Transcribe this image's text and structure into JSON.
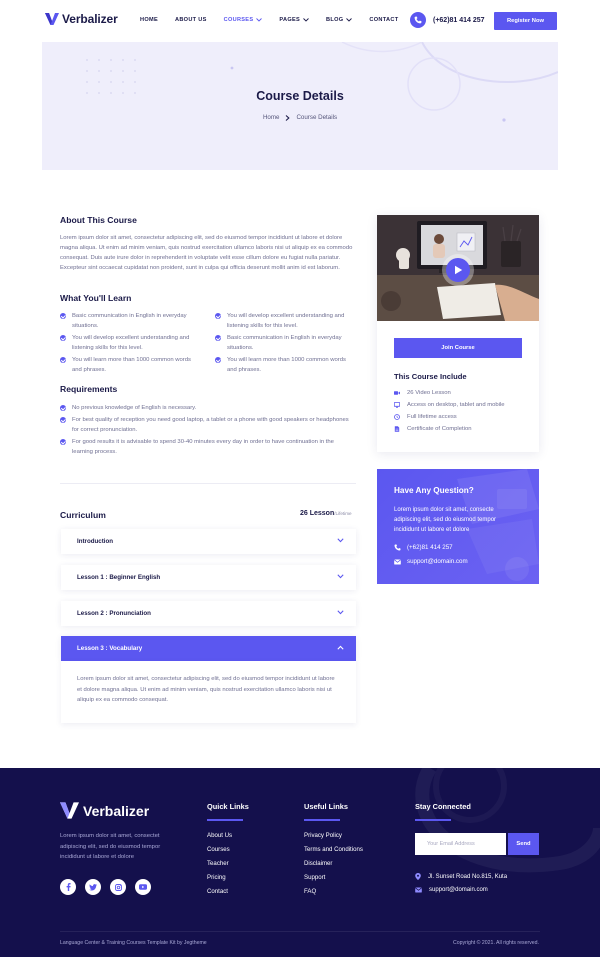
{
  "nav": {
    "brand": "Verbalizer",
    "items": [
      {
        "label": "HOME",
        "dropdown": false,
        "active": false
      },
      {
        "label": "ABOUT US",
        "dropdown": false,
        "active": false
      },
      {
        "label": "COURSES",
        "dropdown": true,
        "active": true
      },
      {
        "label": "PAGES",
        "dropdown": true,
        "active": false
      },
      {
        "label": "BLOG",
        "dropdown": true,
        "active": false
      },
      {
        "label": "CONTACT",
        "dropdown": false,
        "active": false
      }
    ],
    "phone": "(+62)81 414 257",
    "register_label": "Register Now"
  },
  "hero": {
    "title": "Course Details",
    "breadcrumb": [
      "Home",
      "Course Details"
    ]
  },
  "about": {
    "heading": "About This Course",
    "text": "Lorem ipsum dolor sit amet, consectetur adipiscing elit, sed do eiusmod tempor incididunt ut labore et dolore magna aliqua. Ut enim ad minim veniam, quis nostrud exercitation ullamco laboris nisi ut aliquip ex ea commodo consequat. Duis aute irure dolor in reprehenderit in voluptate velit esse cillum dolore eu fugiat nulla pariatur. Excepteur sint occaecat cupidatat non proident, sunt in culpa qui officia deserunt mollit anim id est laborum."
  },
  "learn": {
    "heading": "What You'll Learn",
    "items": [
      "Basic communication in English in everyday situations.",
      "You will develop excellent understanding and listening skills for this level.",
      "You will develop excellent understanding and listening skills for this level.",
      "Basic communication in English in everyday situations.",
      "You will learn more than 1000 common words and phrases.",
      "You will learn more than 1000 common words and phrases."
    ]
  },
  "requirements": {
    "heading": "Requirements",
    "items": [
      "No previous knowledge of English is necessary.",
      "For best quality of reception you need good laptop, a tablet or a phone with good speakers or headphones for correct pronunciation.",
      "For good results it is advisable to spend 30-40 minutes every day in order to have continuation in the learning process."
    ]
  },
  "curriculum": {
    "heading": "Curriculum",
    "count": "26 Lesson",
    "count_suffix": "/Lifetime",
    "lessons": [
      {
        "title": "Introduction",
        "open": false
      },
      {
        "title": "Lesson 1 : Beginner English",
        "open": false
      },
      {
        "title": "Lesson 2 : Pronunciation",
        "open": false
      },
      {
        "title": "Lesson 3 : Vocabulary",
        "open": true
      }
    ],
    "open_text": "Lorem ipsum dolor sit amet, consectetur adipiscing elit, sed do eiusmod tempor incididunt ut labore et dolore magna aliqua. Ut enim ad minim veniam, quis nostrud exercitation ullamco laboris nisi ut aliquip ex ea commodo consequat."
  },
  "sidebar": {
    "join_label": "Join Course",
    "include_heading": "This Course Include",
    "includes": [
      {
        "icon": "video-icon",
        "text": "26 Video Lesson"
      },
      {
        "icon": "monitor-icon",
        "text": "Access on desktop, tablet and mobile"
      },
      {
        "icon": "clock-icon",
        "text": "Full lifetime access"
      },
      {
        "icon": "certificate-icon",
        "text": "Certificate of Completion"
      }
    ]
  },
  "question": {
    "heading": "Have Any Question?",
    "text": "Lorem ipsum dolor sit amet, consecte adipiscing elit, sed do eiusmod tempor incididunt ut labore et dolore",
    "phone": "(+62)81 414 257",
    "email": "support@domain.com"
  },
  "footer": {
    "brand": "Verbalizer",
    "text": "Lorem ipsum dolor sit amet, consectet adipiscing elit, sed do eiusmod tempor incididunt ut labore et dolore",
    "quick_links_heading": "Quick Links",
    "quick_links": [
      "About Us",
      "Courses",
      "Teacher",
      "Pricing",
      "Contact"
    ],
    "useful_links_heading": "Useful Links",
    "useful_links": [
      "Privacy Policy",
      "Terms and Conditions",
      "Disclaimer",
      "Support",
      "FAQ"
    ],
    "stay_heading": "Stay Connected",
    "email_placeholder": "Your Email Address",
    "send_label": "Send",
    "address": "Jl. Sunset Road No.815, Kuta",
    "email": "support@domain.com",
    "bottom_left": "Language Center & Training Courses Template Kit by Jegtheme",
    "bottom_right": "Copyright © 2021. All rights reserved."
  },
  "colors": {
    "accent": "#5b57f0",
    "dark": "#1b1a48",
    "footer_bg": "#14104c",
    "hero_bg": "#efeefb"
  }
}
